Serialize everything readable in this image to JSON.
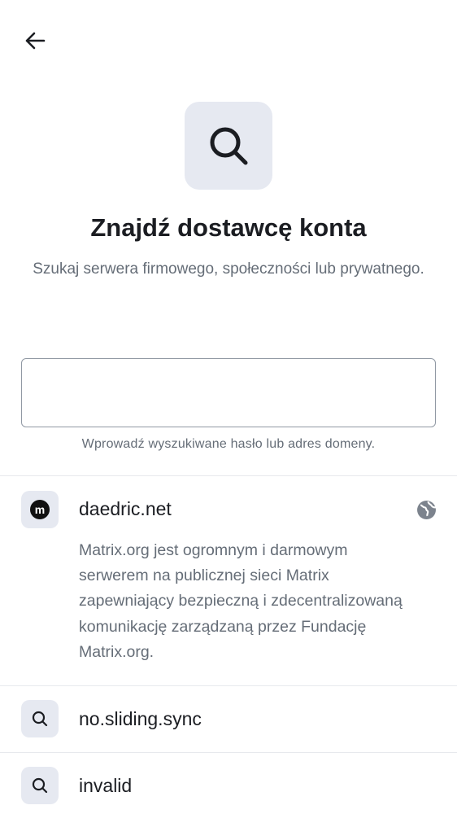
{
  "header": {
    "back_icon": "arrow-left-icon"
  },
  "hero": {
    "icon": "search-icon",
    "title": "Znajdź dostawcę konta",
    "subtitle": "Szukaj serwera firmowego, społeczności lub prywatnego."
  },
  "search": {
    "value": "",
    "placeholder": "",
    "helper": "Wprowadź wyszukiwane hasło lub adres domeny."
  },
  "results": [
    {
      "icon": "matrix-logo-icon",
      "logo_letter": "m",
      "title": "daedric.net",
      "trailing_icon": "globe-icon",
      "description": "Matrix.org jest ogromnym i darmowym serwerem na publicznej sieci Matrix zapewniający bezpieczną i zdecentralizowaną komunikację zarządzaną przez Fundację Matrix.org."
    },
    {
      "icon": "search-icon",
      "title": "no.sliding.sync"
    },
    {
      "icon": "search-icon",
      "title": "invalid"
    }
  ],
  "colors": {
    "icon_bg": "#e6e9f1",
    "secondary_text": "#656d77",
    "primary_text": "#1b1d22"
  }
}
